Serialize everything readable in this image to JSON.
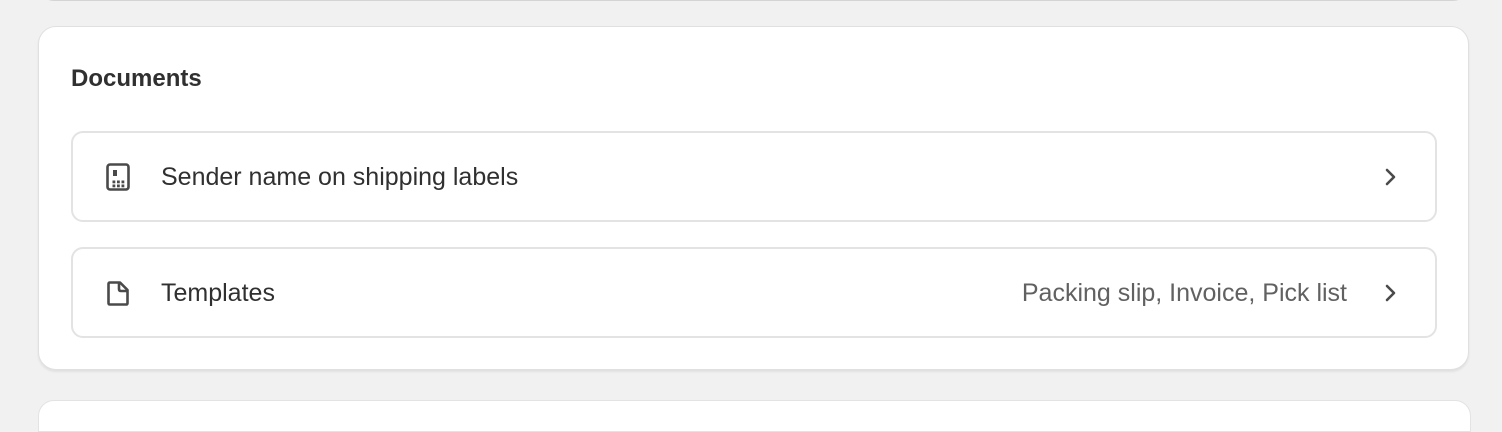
{
  "section": {
    "title": "Documents"
  },
  "rows": [
    {
      "icon": "receipt-icon",
      "label": "Sender name on shipping labels",
      "value": ""
    },
    {
      "icon": "file-icon",
      "label": "Templates",
      "value": "Packing slip, Invoice, Pick list"
    }
  ],
  "colors": {
    "background": "#f1f1f1",
    "card": "#ffffff",
    "text": "#303030",
    "secondary_text": "#616161",
    "border": "#e3e3e3"
  }
}
